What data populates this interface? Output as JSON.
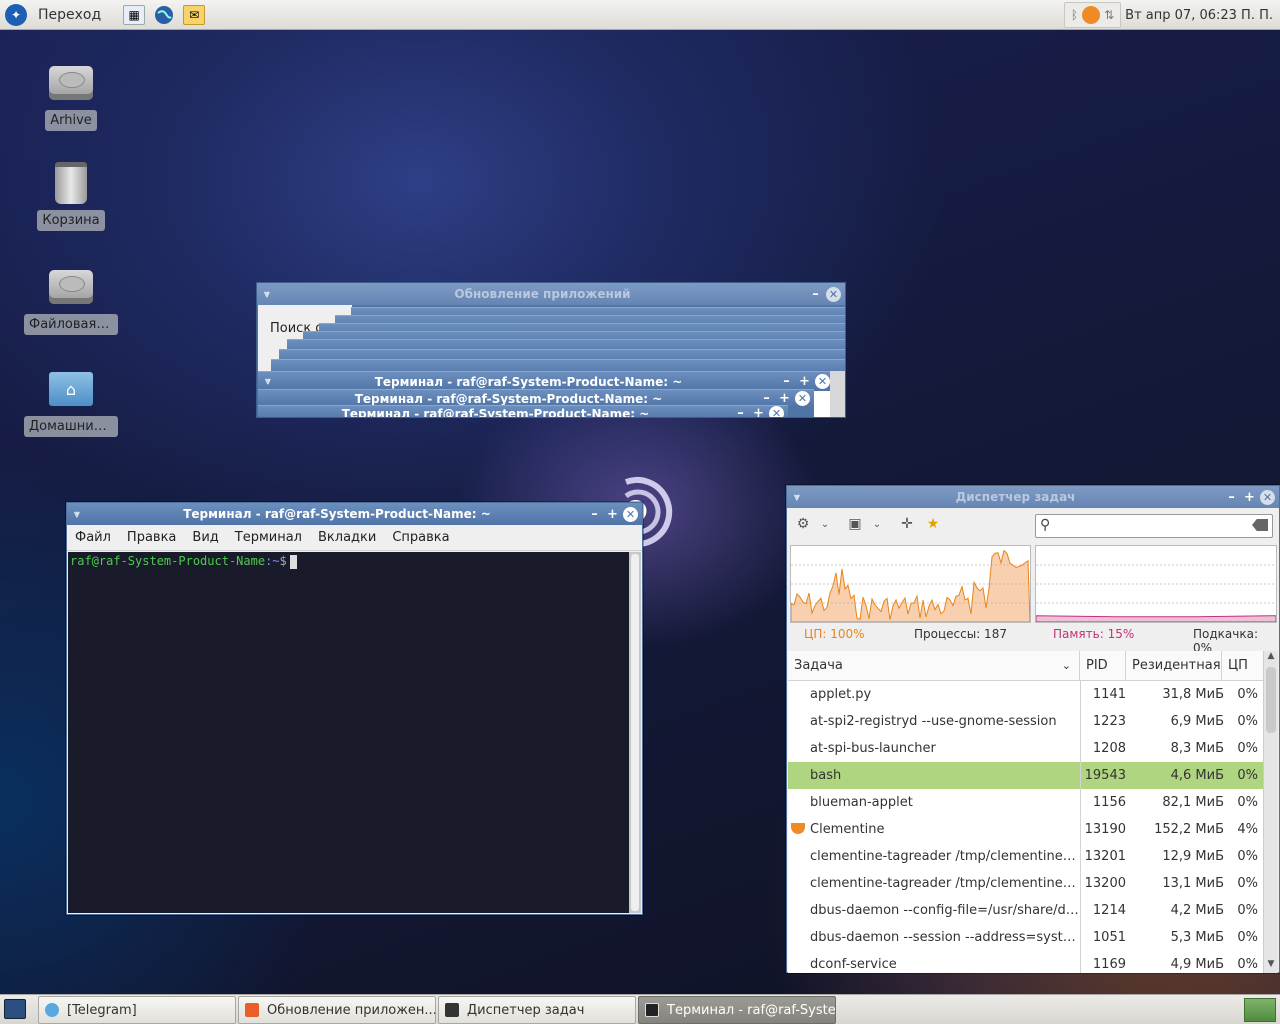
{
  "top_panel": {
    "menu_label": "Переход",
    "clock": "Вт апр 07, 06:23 П. П."
  },
  "desktop_icons": [
    {
      "label": "Arhive"
    },
    {
      "label": "Корзина"
    },
    {
      "label": "Файловая с..."
    },
    {
      "label": "Домашний ..."
    }
  ],
  "update_window": {
    "title": "Обновление приложений",
    "search_label": "Поиск о"
  },
  "stacked_terminals": [
    {
      "title": "Терминал - raf@raf-System-Product-Name: ~"
    },
    {
      "title": "Терминал - raf@raf-System-Product-Name: ~"
    },
    {
      "title": "Терминал - raf@raf-System-Product-Name: ~"
    }
  ],
  "terminal": {
    "title": "Терминал - raf@raf-System-Product-Name: ~",
    "menu": [
      "Файл",
      "Правка",
      "Вид",
      "Терминал",
      "Вкладки",
      "Справка"
    ],
    "prompt_user": "raf@raf-System-Product-Name",
    "prompt_path": ":~",
    "prompt_symbol": "$"
  },
  "task_manager": {
    "title": "Диспетчер задач",
    "cpu_label": "ЦП: 100%",
    "processes_label": "Процессы: 187",
    "memory_label": "Память: 15%",
    "swap_label": "Подкачка: 0%",
    "cpu_percent": 100,
    "memory_percent": 15,
    "columns": [
      "Задача",
      "PID",
      "Резидентная",
      "ЦП"
    ],
    "rows": [
      [
        "applet.py",
        "1141",
        "31,8 МиБ",
        "0%"
      ],
      [
        "at-spi2-registryd --use-gnome-session",
        "1223",
        "6,9 МиБ",
        "0%"
      ],
      [
        "at-spi-bus-launcher",
        "1208",
        "8,3 МиБ",
        "0%"
      ],
      [
        "bash",
        "19543",
        "4,6 МиБ",
        "0%"
      ],
      [
        "blueman-applet",
        "1156",
        "82,1 МиБ",
        "0%"
      ],
      [
        "Clementine",
        "13190",
        "152,2 МиБ",
        "4%"
      ],
      [
        "clementine-tagreader /tmp/clementine_...",
        "13201",
        "12,9 МиБ",
        "0%"
      ],
      [
        "clementine-tagreader /tmp/clementine_...",
        "13200",
        "13,1 МиБ",
        "0%"
      ],
      [
        "dbus-daemon --config-file=/usr/share/def...",
        "1214",
        "4,2 МиБ",
        "0%"
      ],
      [
        "dbus-daemon --session --address=system...",
        "1051",
        "5,3 МиБ",
        "0%"
      ],
      [
        "dconf-service",
        "1169",
        "4,9 МиБ",
        "0%"
      ]
    ],
    "selected_row": 3,
    "colors": {
      "cpu": "#e8851a",
      "memory": "#c4307a",
      "selection": "#b0d580"
    }
  },
  "taskbar": [
    {
      "label": "[Telegram]",
      "icon": "telegram-icon"
    },
    {
      "label": "Обновление приложен...",
      "icon": "update-icon"
    },
    {
      "label": "Диспетчер задач",
      "icon": "taskmanager-icon"
    },
    {
      "label": "Терминал - raf@raf-Syste...",
      "icon": "terminal-icon",
      "active": true
    }
  ]
}
